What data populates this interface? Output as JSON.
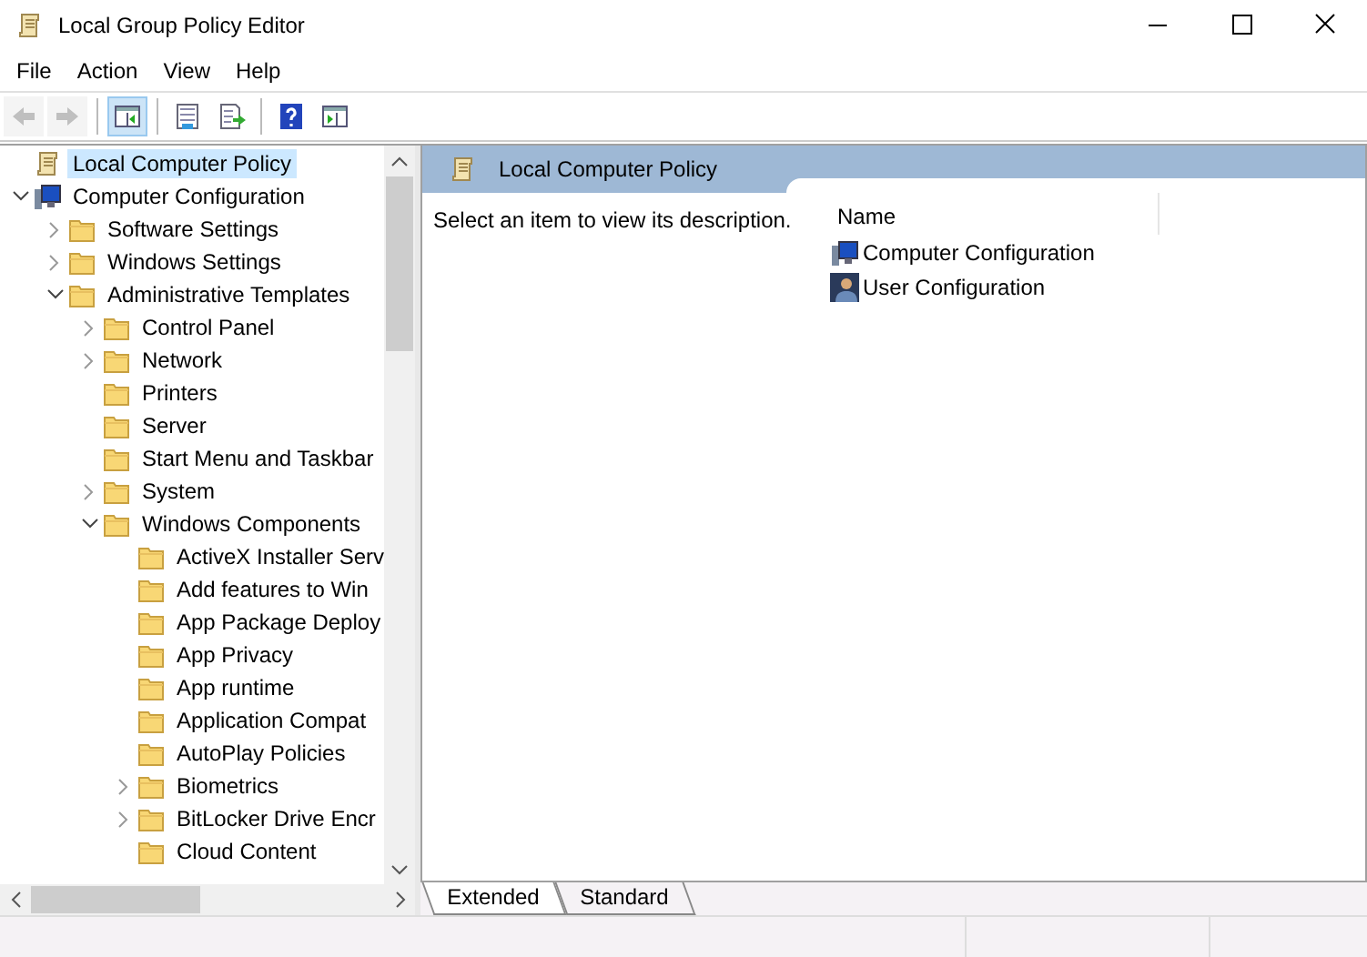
{
  "window": {
    "title": "Local Group Policy Editor"
  },
  "menu": [
    "File",
    "Action",
    "View",
    "Help"
  ],
  "toolbar_groups": [
    {
      "buttons": [
        {
          "kind": "back",
          "disabled": true,
          "pressed": false
        },
        {
          "kind": "forward",
          "disabled": true,
          "pressed": false
        }
      ]
    },
    {
      "buttons": [
        {
          "kind": "tree",
          "disabled": false,
          "pressed": true
        }
      ]
    },
    {
      "buttons": [
        {
          "kind": "properties",
          "disabled": false,
          "pressed": false
        },
        {
          "kind": "export",
          "disabled": false,
          "pressed": false
        }
      ]
    },
    {
      "buttons": [
        {
          "kind": "help",
          "disabled": false,
          "pressed": false
        },
        {
          "kind": "actionpane",
          "disabled": false,
          "pressed": false
        }
      ]
    }
  ],
  "tree": [
    {
      "label": "Local Computer Policy",
      "kind": "root",
      "selected": true
    },
    {
      "label": "Computer Configuration",
      "kind": "computer",
      "expanded": true,
      "selected": false,
      "children": [
        {
          "label": "Software Settings",
          "kind": "branch",
          "expanded": false,
          "selected": false
        },
        {
          "label": "Windows Settings",
          "kind": "branch",
          "expanded": false,
          "selected": false
        },
        {
          "label": "Administrative Templates",
          "kind": "branch",
          "expanded": true,
          "selected": false,
          "children": [
            {
              "label": "Control Panel",
              "kind": "branch",
              "expanded": false,
              "selected": false
            },
            {
              "label": "Network",
              "kind": "branch",
              "expanded": false,
              "selected": false
            },
            {
              "label": "Printers",
              "kind": "leaf",
              "selected": false
            },
            {
              "label": "Server",
              "kind": "leaf",
              "selected": false
            },
            {
              "label": "Start Menu and Taskbar",
              "kind": "leaf",
              "selected": false
            },
            {
              "label": "System",
              "kind": "branch",
              "expanded": false,
              "selected": false
            },
            {
              "label": "Windows Components",
              "kind": "branch",
              "expanded": true,
              "selected": false,
              "children": [
                {
                  "label": "ActiveX Installer Serv",
                  "kind": "leaf",
                  "selected": false
                },
                {
                  "label": "Add features to Win",
                  "kind": "leaf",
                  "selected": false
                },
                {
                  "label": "App Package Deploy",
                  "kind": "leaf",
                  "selected": false
                },
                {
                  "label": "App Privacy",
                  "kind": "leaf",
                  "selected": false
                },
                {
                  "label": "App runtime",
                  "kind": "leaf",
                  "selected": false
                },
                {
                  "label": "Application Compat",
                  "kind": "leaf",
                  "selected": false
                },
                {
                  "label": "AutoPlay Policies",
                  "kind": "leaf",
                  "selected": false
                },
                {
                  "label": "Biometrics",
                  "kind": "branch",
                  "expanded": false,
                  "selected": false
                },
                {
                  "label": "BitLocker Drive Encr",
                  "kind": "branch",
                  "expanded": false,
                  "selected": false
                },
                {
                  "label": "Cloud Content",
                  "kind": "leaf",
                  "selected": false
                }
              ]
            }
          ]
        }
      ]
    }
  ],
  "content": {
    "header": "Local Computer Policy",
    "description": "Select an item to view its description.",
    "column": "Name",
    "items": [
      {
        "label": "Computer Configuration",
        "kind": "computer"
      },
      {
        "label": "User Configuration",
        "kind": "user"
      }
    ]
  },
  "view_tabs": [
    {
      "label": "Extended",
      "selected": true
    },
    {
      "label": "Standard",
      "selected": false
    }
  ]
}
